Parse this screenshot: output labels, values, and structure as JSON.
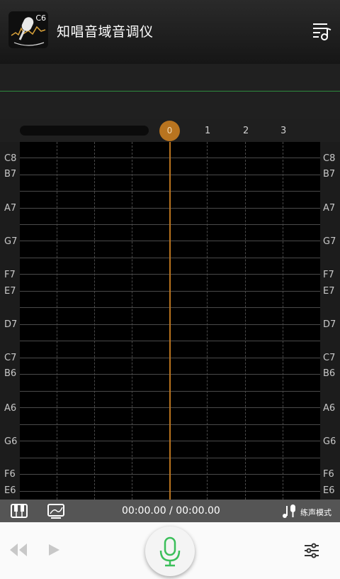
{
  "app": {
    "title": "知唱音域音调仪",
    "logo_note": "C6"
  },
  "timeline": {
    "playhead_label": "0",
    "ticks": [
      "1",
      "2",
      "3"
    ]
  },
  "notes": [
    "C8",
    "B7",
    "A7",
    "G7",
    "F7",
    "E7",
    "D7",
    "C7",
    "B6",
    "A6",
    "G6",
    "F6",
    "E6"
  ],
  "status": {
    "time": "00:00.00 / 00:00.00",
    "mode_label": "练声模式"
  },
  "colors": {
    "accent": "#b9741f",
    "wave": "#2e8b3e",
    "mic": "#3bbf5a"
  },
  "icons": {
    "menu": "playlist-music-icon",
    "piano": "piano-icon",
    "chart": "trend-chart-icon",
    "mode": "microphone-note-icon",
    "rewind": "rewind-icon",
    "play": "play-icon",
    "mic": "microphone-icon",
    "settings": "sliders-icon"
  }
}
